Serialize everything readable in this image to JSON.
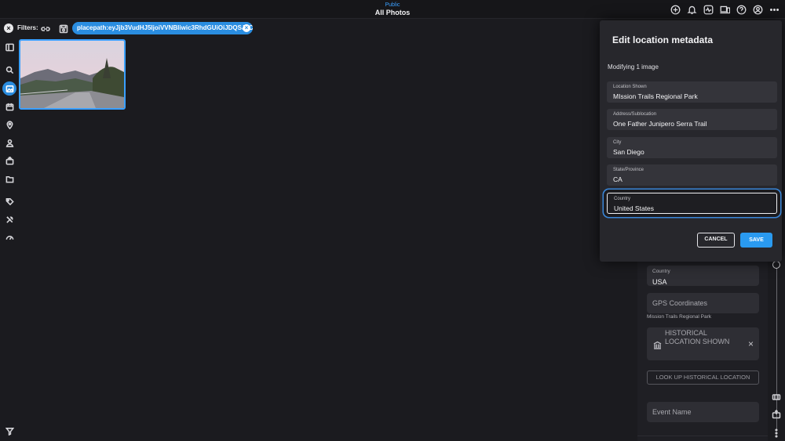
{
  "header": {
    "context": "Public",
    "title": "All Photos",
    "icons": [
      "add-icon",
      "bell-icon",
      "activity-icon",
      "devices-icon",
      "help-icon",
      "account-icon",
      "more-icon"
    ]
  },
  "filterbar": {
    "label": "Filters:",
    "chip_text": "placepath:eyJjb3VudHJ5IjoiVVNBIiwic3RhdGUiOiJDQSJ9Cg=="
  },
  "sidebar": {
    "icons": [
      "panel-toggle-icon",
      "search-icon",
      "photos-icon",
      "calendar-icon",
      "location-icon",
      "people-icon",
      "collections-icon",
      "folder-icon",
      "tags-icon",
      "tools-icon",
      "dashboard-icon",
      "filter-icon"
    ],
    "active": "photos-icon"
  },
  "side_panel": {
    "country_label": "Country",
    "country_value": "USA",
    "gps_placeholder": "GPS Coordinates",
    "gps_note": "Mission Trails Regional Park",
    "historical_placeholder": "HISTORICAL LOCATION SHOWN",
    "lookup_button": "LOOK UP HISTORICAL LOCATION",
    "event_placeholder": "Event Name"
  },
  "dialog": {
    "title": "Edit location metadata",
    "subtitle": "Modifying 1 image",
    "fields": [
      {
        "label": "Location Shown",
        "value": "MIssion Trails Regional Park"
      },
      {
        "label": "Address/Sublocation",
        "value": "One Father Junipero Serra Trail"
      },
      {
        "label": "City",
        "value": "San Diego"
      },
      {
        "label": "State/Province",
        "value": "CA"
      },
      {
        "label": "Country",
        "value": "United States"
      }
    ],
    "cancel_label": "CANCEL",
    "save_label": "SAVE"
  },
  "colors": {
    "accent": "#2a8de0",
    "background": "#1b1b1f",
    "panel": "#27272c"
  }
}
